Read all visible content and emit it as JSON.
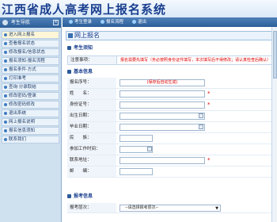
{
  "header": {
    "title": "江西省成人高考网上报名系统"
  },
  "sidebar": {
    "title": "考生导航",
    "items": [
      "进入网上报名",
      "查看报名状态",
      "修改报名/信息状态",
      "报名须知·报名流程",
      "报名条件·方式",
      "打印准考",
      "查询·分录取结",
      "修改密码/登录",
      "修改密码修改",
      "退出系统",
      "网上报名说明",
      "报名信息须知",
      "联系我们"
    ]
  },
  "toolbar": {
    "item1": "考生登录",
    "item2": "报名流程",
    "item3": "退出"
  },
  "main": {
    "panel_title": "网上报名",
    "section_notice": "考生须知",
    "notice_label": "注意事项：",
    "notice_text": "报名需要先填写（务必按照身份证件填写，本次填写后不得修改；请认真检查后确认）",
    "section_basic": "基本信息",
    "fields": [
      {
        "label": "报名序号：",
        "value": "(保存后自动生成)"
      },
      {
        "label": "姓　　名：",
        "value": ""
      },
      {
        "label": "身份证号：",
        "value": ""
      },
      {
        "label": "出生日期：",
        "value": ""
      },
      {
        "label": "毕业日期：",
        "value": ""
      },
      {
        "label": "民　　族：",
        "value": ""
      },
      {
        "label": "参加工作时间：",
        "value": ""
      },
      {
        "label": "联系地址：",
        "value": ""
      },
      {
        "label": "邮　　编：",
        "value": ""
      }
    ],
    "section_exam": "报考信息",
    "exam_label": "报考层次：",
    "exam_select": "--请选择报考层次--"
  }
}
